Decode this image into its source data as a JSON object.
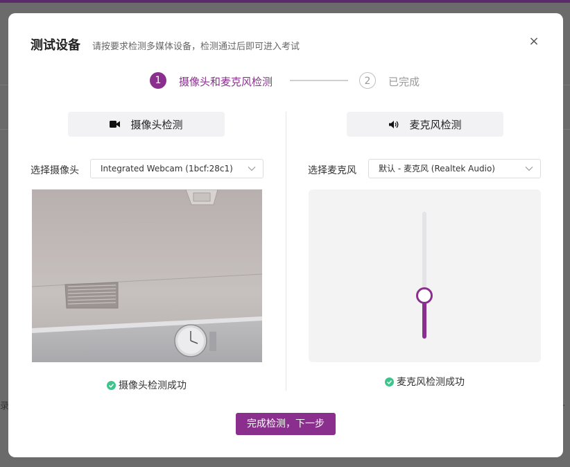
{
  "background": {
    "left_text": "录",
    "right_text": "t."
  },
  "dialog": {
    "title": "测试设备",
    "subtitle": "请按要求检测多媒体设备，检测通过后即可进入考试",
    "close_symbol": "×"
  },
  "steps": [
    {
      "number": "1",
      "label": "摄像头和麦克风检测",
      "state": "active"
    },
    {
      "number": "2",
      "label": "已完成",
      "state": "pending"
    }
  ],
  "camera": {
    "section_label": "摄像头检测",
    "select_label": "选择摄像头",
    "selected_device": "Integrated Webcam (1bcf:28c1)",
    "status_text": "摄像头检测成功"
  },
  "microphone": {
    "section_label": "麦克风检测",
    "select_label": "选择麦克风",
    "selected_device": "默认 - 麦克风 (Realtek Audio)",
    "volume_level": 0.34,
    "status_text": "麦克风检测成功"
  },
  "actions": {
    "finish_label": "完成检测，下一步"
  },
  "colors": {
    "accent": "#8b2f8e",
    "success": "#3cc48c"
  },
  "icons": {
    "camera": "video-camera-icon",
    "microphone": "speaker-icon",
    "chevron": "chevron-down-icon",
    "success": "check-circle-icon"
  }
}
